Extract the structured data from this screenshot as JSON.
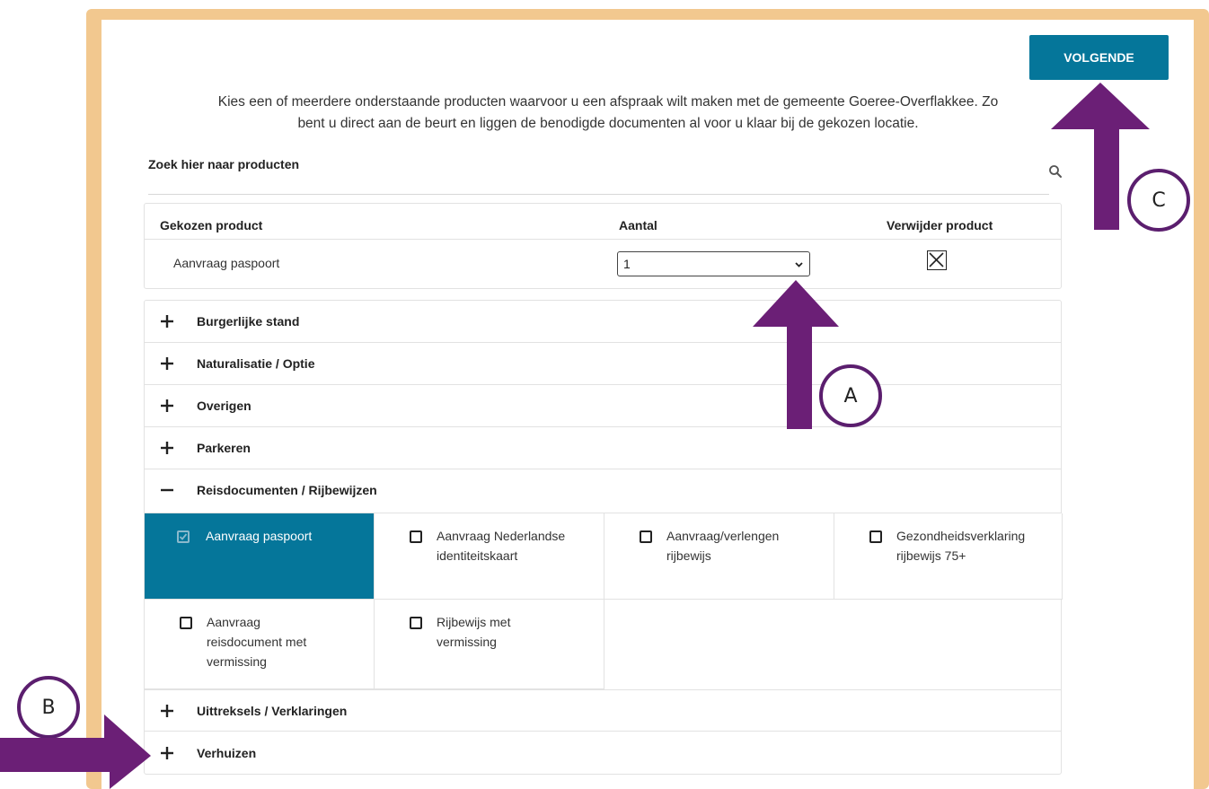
{
  "toolbar": {
    "next_label": "VOLGENDE"
  },
  "intro": {
    "line1": "Kies een of meerdere onderstaande producten waarvoor u een afspraak wilt maken met de gemeente Goeree-Overflakkee. Zo",
    "line2": "bent u direct aan de beurt en liggen de benodigde documenten al voor u klaar bij de gekozen locatie."
  },
  "search": {
    "label": "Zoek hier naar producten",
    "icon": "search-icon"
  },
  "chosen": {
    "headers": {
      "product": "Gekozen product",
      "quantity": "Aantal",
      "remove": "Verwijder product"
    },
    "rows": [
      {
        "product": "Aanvraag paspoort",
        "quantity": "1"
      }
    ]
  },
  "categories": [
    {
      "label": "Burgerlijke stand",
      "expanded": false
    },
    {
      "label": "Naturalisatie / Optie",
      "expanded": false
    },
    {
      "label": "Overigen",
      "expanded": false
    },
    {
      "label": "Parkeren",
      "expanded": false
    },
    {
      "label": "Reisdocumenten / Rijbewijzen",
      "expanded": true
    },
    {
      "label": "Uittreksels / Verklaringen",
      "expanded": false
    },
    {
      "label": "Verhuizen",
      "expanded": false
    }
  ],
  "products": [
    {
      "lines": [
        "Aanvraag paspoort"
      ],
      "checked": true
    },
    {
      "lines": [
        "Aanvraag Nederlandse",
        "identiteitskaart"
      ],
      "checked": false
    },
    {
      "lines": [
        "Aanvraag/verlengen",
        "rijbewijs"
      ],
      "checked": false
    },
    {
      "lines": [
        "Gezondheidsverklaring",
        "rijbewijs 75+"
      ],
      "checked": false
    },
    {
      "lines": [
        "Aanvraag",
        "reisdocument met",
        "vermissing"
      ],
      "checked": false
    },
    {
      "lines": [
        "Rijbewijs met",
        "vermissing"
      ],
      "checked": false
    }
  ],
  "annotations": {
    "a": "A",
    "b": "B",
    "c": "C"
  },
  "colors": {
    "primary": "#05769a",
    "frame": "#f2c88f",
    "annotation": "#6b1f76"
  }
}
